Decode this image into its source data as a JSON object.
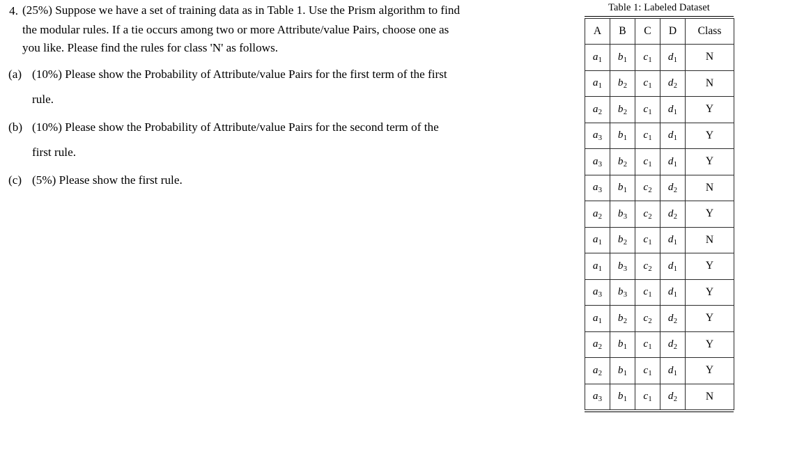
{
  "question": {
    "number": "4.",
    "lines": [
      "(25%) Suppose we have a set of training data as in Table 1. Use the Prism algorithm to find",
      "the modular rules. If a tie occurs among two or more Attribute/value Pairs, choose one as",
      "you like. Please find the rules for class 'N' as follows."
    ],
    "subitems": [
      {
        "label": "(a)",
        "lines": [
          "(10%) Please show the Probability of Attribute/value Pairs for the first term of the first",
          "rule."
        ]
      },
      {
        "label": "(b)",
        "lines": [
          "(10%) Please show the Probability of Attribute/value Pairs for the second term of the",
          "first rule."
        ]
      },
      {
        "label": "(c)",
        "lines": [
          "(5%) Please show the first rule."
        ]
      }
    ]
  },
  "table": {
    "caption": "Table 1: Labeled Dataset",
    "columns": [
      "A",
      "B",
      "C",
      "D",
      "Class"
    ],
    "rows": [
      {
        "A": {
          "base": "a",
          "sub": "1"
        },
        "B": {
          "base": "b",
          "sub": "1"
        },
        "C": {
          "base": "c",
          "sub": "1"
        },
        "D": {
          "base": "d",
          "sub": "1"
        },
        "Class": "N"
      },
      {
        "A": {
          "base": "a",
          "sub": "1"
        },
        "B": {
          "base": "b",
          "sub": "2"
        },
        "C": {
          "base": "c",
          "sub": "1"
        },
        "D": {
          "base": "d",
          "sub": "2"
        },
        "Class": "N"
      },
      {
        "A": {
          "base": "a",
          "sub": "2"
        },
        "B": {
          "base": "b",
          "sub": "2"
        },
        "C": {
          "base": "c",
          "sub": "1"
        },
        "D": {
          "base": "d",
          "sub": "1"
        },
        "Class": "Y"
      },
      {
        "A": {
          "base": "a",
          "sub": "3"
        },
        "B": {
          "base": "b",
          "sub": "1"
        },
        "C": {
          "base": "c",
          "sub": "1"
        },
        "D": {
          "base": "d",
          "sub": "1"
        },
        "Class": "Y"
      },
      {
        "A": {
          "base": "a",
          "sub": "3"
        },
        "B": {
          "base": "b",
          "sub": "2"
        },
        "C": {
          "base": "c",
          "sub": "1"
        },
        "D": {
          "base": "d",
          "sub": "1"
        },
        "Class": "Y"
      },
      {
        "A": {
          "base": "a",
          "sub": "3"
        },
        "B": {
          "base": "b",
          "sub": "1"
        },
        "C": {
          "base": "c",
          "sub": "2"
        },
        "D": {
          "base": "d",
          "sub": "2"
        },
        "Class": "N"
      },
      {
        "A": {
          "base": "a",
          "sub": "2"
        },
        "B": {
          "base": "b",
          "sub": "3"
        },
        "C": {
          "base": "c",
          "sub": "2"
        },
        "D": {
          "base": "d",
          "sub": "2"
        },
        "Class": "Y"
      },
      {
        "A": {
          "base": "a",
          "sub": "1"
        },
        "B": {
          "base": "b",
          "sub": "2"
        },
        "C": {
          "base": "c",
          "sub": "1"
        },
        "D": {
          "base": "d",
          "sub": "1"
        },
        "Class": "N"
      },
      {
        "A": {
          "base": "a",
          "sub": "1"
        },
        "B": {
          "base": "b",
          "sub": "3"
        },
        "C": {
          "base": "c",
          "sub": "2"
        },
        "D": {
          "base": "d",
          "sub": "1"
        },
        "Class": "Y"
      },
      {
        "A": {
          "base": "a",
          "sub": "3"
        },
        "B": {
          "base": "b",
          "sub": "3"
        },
        "C": {
          "base": "c",
          "sub": "1"
        },
        "D": {
          "base": "d",
          "sub": "1"
        },
        "Class": "Y"
      },
      {
        "A": {
          "base": "a",
          "sub": "1"
        },
        "B": {
          "base": "b",
          "sub": "2"
        },
        "C": {
          "base": "c",
          "sub": "2"
        },
        "D": {
          "base": "d",
          "sub": "2"
        },
        "Class": "Y"
      },
      {
        "A": {
          "base": "a",
          "sub": "2"
        },
        "B": {
          "base": "b",
          "sub": "1"
        },
        "C": {
          "base": "c",
          "sub": "1"
        },
        "D": {
          "base": "d",
          "sub": "2"
        },
        "Class": "Y"
      },
      {
        "A": {
          "base": "a",
          "sub": "2"
        },
        "B": {
          "base": "b",
          "sub": "1"
        },
        "C": {
          "base": "c",
          "sub": "1"
        },
        "D": {
          "base": "d",
          "sub": "1"
        },
        "Class": "Y"
      },
      {
        "A": {
          "base": "a",
          "sub": "3"
        },
        "B": {
          "base": "b",
          "sub": "1"
        },
        "C": {
          "base": "c",
          "sub": "1"
        },
        "D": {
          "base": "d",
          "sub": "2"
        },
        "Class": "N"
      }
    ]
  },
  "colors": {
    "page_background": "#ffffff",
    "text": "#000000",
    "table_rule": "#2b2b2b"
  }
}
